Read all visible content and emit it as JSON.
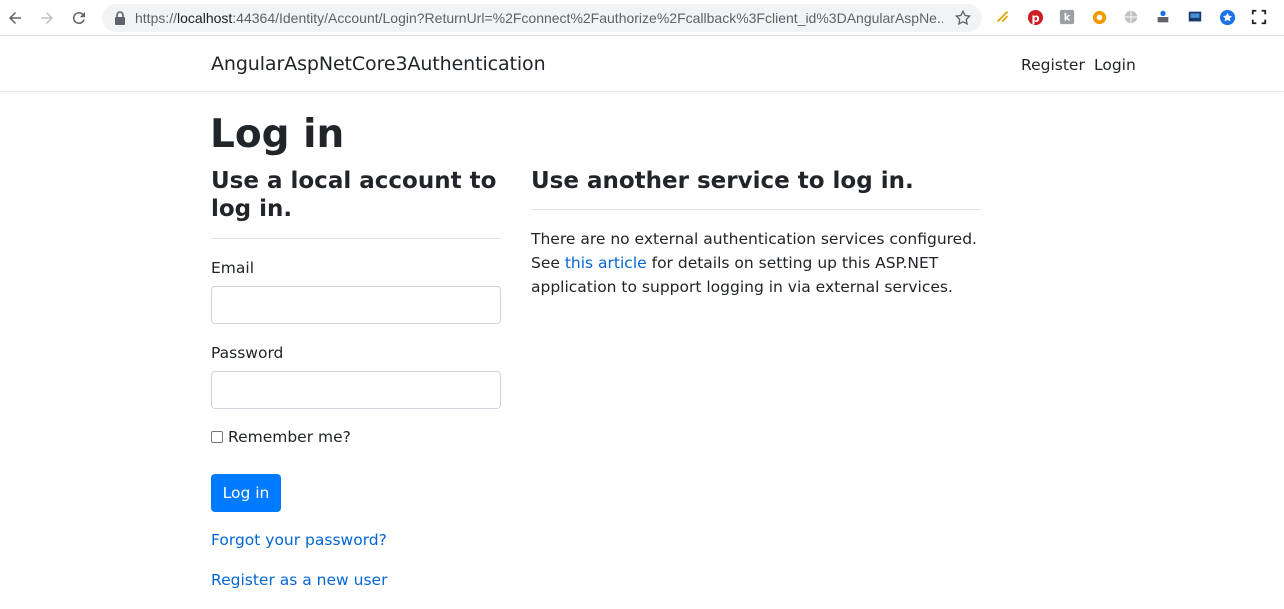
{
  "browser": {
    "url_prefix": "https://",
    "url_host": "localhost",
    "url_rest": ":44364/Identity/Account/Login?ReturnUrl=%2Fconnect%2Fauthorize%2Fcallback%3Fclient_id%3DAngularAspNe..."
  },
  "navbar": {
    "brand": "AngularAspNetCore3Authentication",
    "register": "Register",
    "login": "Login"
  },
  "page": {
    "title": "Log in"
  },
  "local": {
    "heading": "Use a local account to log in.",
    "email_label": "Email",
    "email_value": "",
    "password_label": "Password",
    "password_value": "",
    "remember_label": "Remember me?",
    "login_button": "Log in",
    "forgot_link": "Forgot your password?",
    "register_link": "Register as a new user"
  },
  "external": {
    "heading": "Use another service to log in.",
    "text_before": "There are no external authentication services configured. See ",
    "link": "this article",
    "text_after": " for details on setting up this ASP.NET application to support logging in via external services."
  },
  "colors": {
    "primary": "#007bff",
    "link": "#0366d6",
    "text": "#212529"
  }
}
